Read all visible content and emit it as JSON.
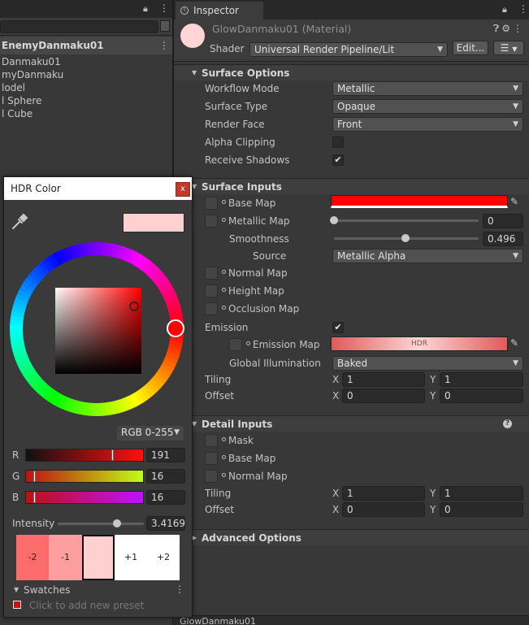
{
  "hierarchy": {
    "scene_name": "EnemyDanmaku01",
    "items": [
      "Danmaku01",
      "myDanmaku",
      "lodel",
      "l Sphere",
      "l Cube"
    ]
  },
  "inspector": {
    "tab_label": "Inspector",
    "material_title": "GlowDanmaku01 (Material)",
    "shader_label": "Shader",
    "shader_value": "Universal Render Pipeline/Lit",
    "edit_button": "Edit...",
    "menu_button": "☰",
    "surface_options": {
      "title": "Surface Options",
      "workflow_mode_label": "Workflow Mode",
      "workflow_mode_value": "Metallic",
      "surface_type_label": "Surface Type",
      "surface_type_value": "Opaque",
      "render_face_label": "Render Face",
      "render_face_value": "Front",
      "alpha_clipping_label": "Alpha Clipping",
      "receive_shadows_label": "Receive Shadows"
    },
    "surface_inputs": {
      "title": "Surface Inputs",
      "base_map_label": "Base Map",
      "metallic_map_label": "Metallic Map",
      "metallic_value": "0",
      "metallic_fraction": 0,
      "smoothness_label": "Smoothness",
      "smoothness_value": "0.496",
      "smoothness_fraction": 0.496,
      "source_label": "Source",
      "source_value": "Metallic Alpha",
      "normal_map_label": "Normal Map",
      "height_map_label": "Height Map",
      "occlusion_map_label": "Occlusion Map",
      "emission_label": "Emission",
      "emission_map_label": "Emission Map",
      "emission_hdr_label": "HDR",
      "global_illumination_label": "Global Illumination",
      "global_illumination_value": "Baked",
      "tiling_label": "Tiling",
      "offset_label": "Offset",
      "x_label": "X",
      "y_label": "Y",
      "tiling_x": "1",
      "tiling_y": "1",
      "offset_x": "0",
      "offset_y": "0",
      "base_color": "#ff0000"
    },
    "detail_inputs": {
      "title": "Detail Inputs",
      "mask_label": "Mask",
      "base_map_label": "Base Map",
      "normal_map_label": "Normal Map",
      "tiling_label": "Tiling",
      "offset_label": "Offset",
      "x_label": "X",
      "y_label": "Y",
      "tiling_x": "1",
      "tiling_y": "1",
      "offset_x": "0",
      "offset_y": "0"
    },
    "advanced_options": {
      "title": "Advanced Options"
    },
    "footer_title": "GlowDanmaku01"
  },
  "hdr_color": {
    "title": "HDR Color",
    "close_label": "x",
    "current_color": "#ffd0d0",
    "mode_label": "RGB 0-255",
    "r_label": "R",
    "r_value": "191",
    "r_fraction": 0.749,
    "g_label": "G",
    "g_value": "16",
    "g_fraction": 0.063,
    "b_label": "B",
    "b_value": "16",
    "b_fraction": 0.063,
    "intensity_label": "Intensity",
    "intensity_value": "3.4169",
    "intensity_fraction": 0.69,
    "presets": [
      "-2",
      "-1",
      "",
      "+1",
      "+2"
    ],
    "swatches_label": "Swatches",
    "add_preset_label": "Click to add new preset"
  }
}
